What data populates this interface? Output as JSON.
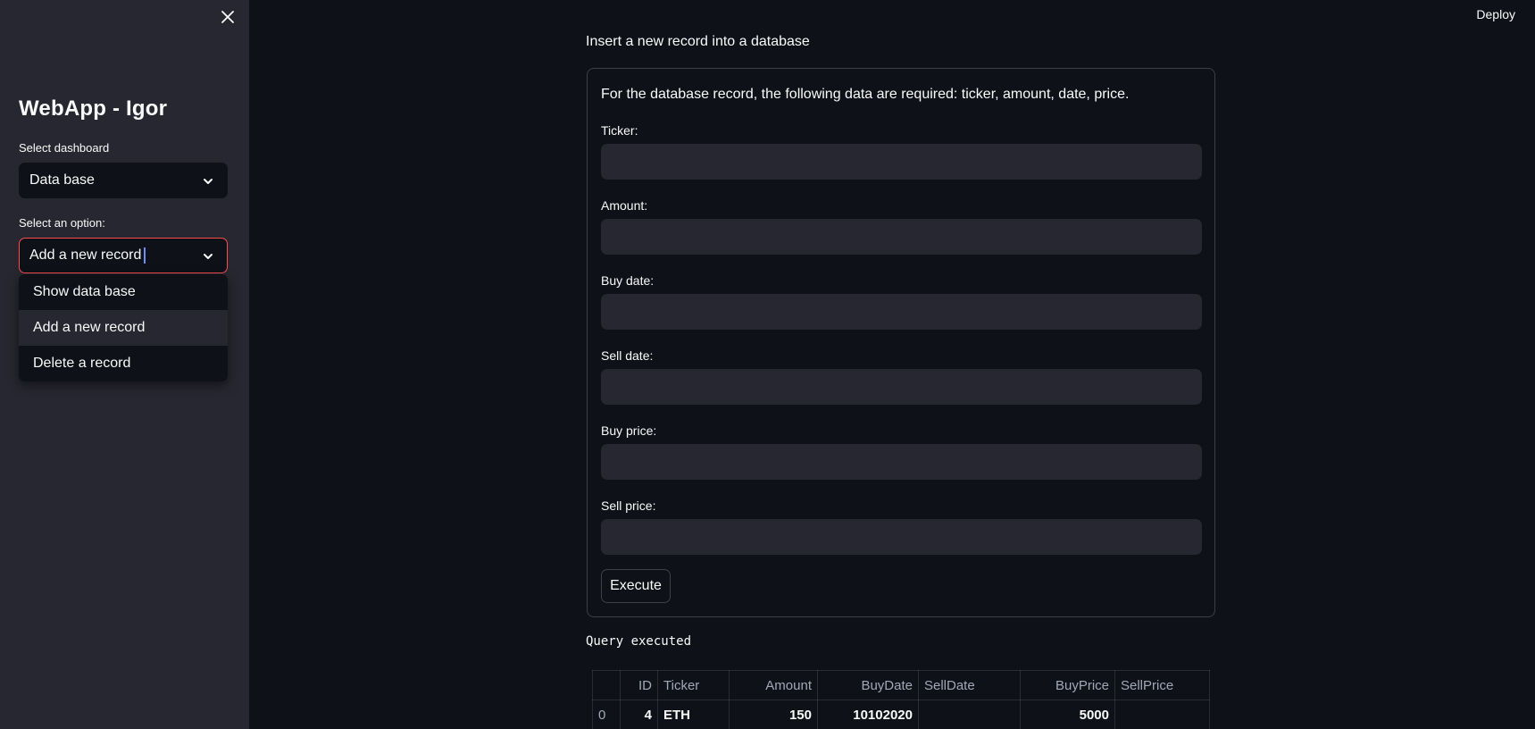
{
  "header": {
    "deploy_label": "Deploy"
  },
  "sidebar": {
    "app_title": "WebApp - Igor",
    "dashboard_label": "Select dashboard",
    "dashboard_value": "Data base",
    "option_label": "Select an option:",
    "option_value": "Add a new record",
    "options": [
      "Show data base",
      "Add a new record",
      "Delete a record"
    ]
  },
  "main": {
    "section_title": "Insert a new record into a database",
    "form": {
      "description": "For the database record, the following data are required: ticker, amount, date, price.",
      "fields": [
        {
          "label": "Ticker:",
          "value": ""
        },
        {
          "label": "Amount:",
          "value": ""
        },
        {
          "label": "Buy date:",
          "value": ""
        },
        {
          "label": "Sell date:",
          "value": ""
        },
        {
          "label": "Buy price:",
          "value": ""
        },
        {
          "label": "Sell price:",
          "value": ""
        }
      ],
      "execute_label": "Execute"
    },
    "query_message": "Query executed",
    "table": {
      "headers": [
        "",
        "ID",
        "Ticker",
        "Amount",
        "BuyDate",
        "SellDate",
        "BuyPrice",
        "SellPrice"
      ],
      "rows": [
        [
          "0",
          "4",
          "ETH",
          "150",
          "10102020",
          "",
          "5000",
          ""
        ]
      ]
    }
  },
  "colors": {
    "background": "#0e1117",
    "sidebar": "#262730",
    "focus_border": "#ff4b4b"
  }
}
